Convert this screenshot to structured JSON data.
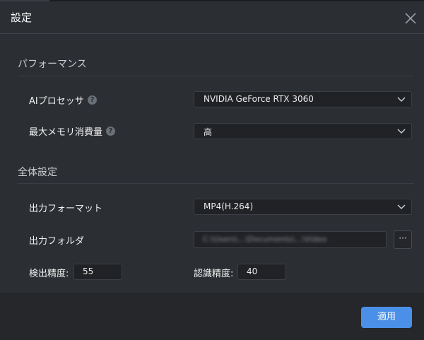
{
  "dialog": {
    "title": "設定",
    "close_icon": "close-icon"
  },
  "performance": {
    "section_title": "パフォーマンス",
    "ai_processor": {
      "label": "AIプロセッサ",
      "help_icon": "help-icon",
      "value": "NVIDIA GeForce RTX 3060"
    },
    "max_memory": {
      "label": "最大メモリ消費量",
      "help_icon": "help-icon",
      "value": "高"
    }
  },
  "general": {
    "section_title": "全体設定",
    "output_format": {
      "label": "出力フォーマット",
      "value": "MP4(H.264)"
    },
    "output_folder": {
      "label": "出力フォルダ",
      "value": "C:\\Users\\...\\Documents\\...\\Video",
      "browse_label": "···"
    },
    "detection_accuracy": {
      "label": "検出精度:",
      "value": "55"
    },
    "recognition_accuracy": {
      "label": "認識精度:",
      "value": "40"
    }
  },
  "footer": {
    "apply_label": "適用"
  },
  "colors": {
    "background": "#2b2e33",
    "field_background": "#202226",
    "accent": "#4a90e9"
  }
}
